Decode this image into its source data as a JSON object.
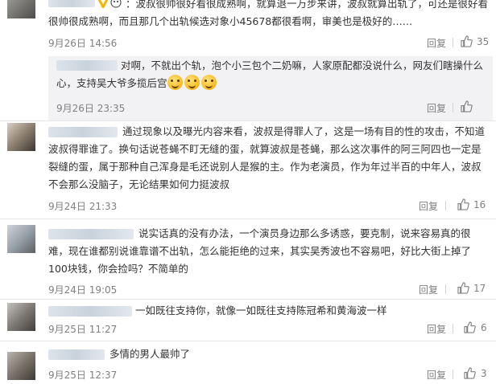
{
  "comments": [
    {
      "text": "：波叔很帅很好看很成熟啊，就算退一万步来讲，波叔就算出轨了，可还是很好看很帅很成熟啊，而且那几个出轨候选对象小45678都很看啊，审美也是极好的……",
      "time": "9月26日 14:56",
      "reply_label": "回复",
      "likes": "35"
    },
    {
      "text": "对啊，不就出个轨，泡个小三包个二奶嘛，人家原配都没说什么，网友们瞎操什么心，支持吴大爷多揽后宫",
      "time": "9月26日 23:35",
      "reply_label": "回复",
      "likes": ""
    },
    {
      "text": "通过现象以及曝光内容来看，波叔是得罪人了，这是一场有目的性的攻击，不知道波叔得罪谁了。换句话说苍蝇不盯无缝的蛋，就算波叔是苍蝇，那么这次事件的阿三阿四也一定是裂缝的蛋，属于那种自己浑身是毛还说别人是猴的主。作为老演员，作为年过半百的中年人，波叔不会那么没脑子，无论结果如何力挺波叔",
      "time": "9月24日 21:33",
      "reply_label": "回复",
      "likes": "16"
    },
    {
      "text": "说实话真的没有办法，一个演员身边那么多诱惑，要克制，说来容易真的很难，现在谁都别说谁靠谱不出轨，怎么能拒绝的过来，其实吴秀波也不容易吧，好比大街上掉了100块钱，你会捡吗？不简单的",
      "time": "9月24日 19:05",
      "reply_label": "回复",
      "likes": "17"
    },
    {
      "text": "一如既往支持你，就像一如既往支持陈冠希和黄海波一样",
      "time": "9月25日 11:27",
      "reply_label": "回复",
      "likes": "6"
    },
    {
      "text": "多情的男人最帅了",
      "time": "9月25日 12:37",
      "reply_label": "回复",
      "likes": "3"
    }
  ],
  "icons": {
    "like": "thumbs-up-icon",
    "verified": "v-badge-icon",
    "emoji": "grin-emoji-icon"
  },
  "colors": {
    "text": "#333333",
    "meta": "#808080",
    "reply_bg": "#f2f2f5",
    "verified_badge": "#f5b700"
  }
}
